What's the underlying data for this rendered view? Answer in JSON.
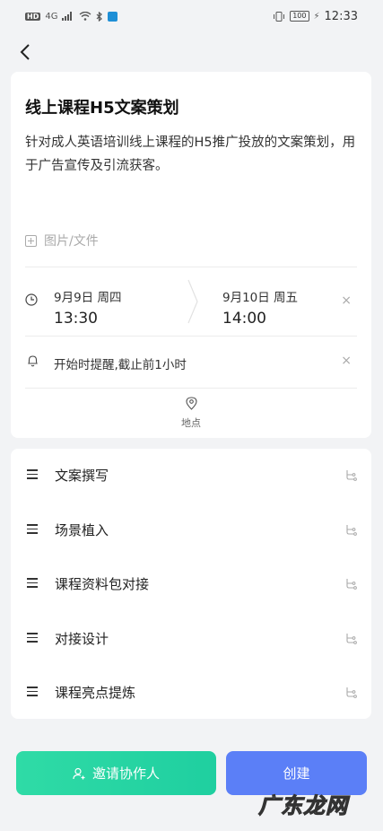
{
  "status_bar": {
    "left_badges": [
      "HD",
      "4G"
    ],
    "battery": "100",
    "time": "12:33"
  },
  "task": {
    "title": "线上课程H5文案策划",
    "description": "针对成人英语培训线上课程的H5推广投放的文案策划，用于广告宣传及引流获客。",
    "attachment_label": "图片/文件"
  },
  "schedule": {
    "start_date": "9月9日 周四",
    "start_time": "13:30",
    "end_date": "9月10日 周五",
    "end_time": "14:00",
    "clear_glyph": "×"
  },
  "reminder": {
    "text": "开始时提醒,截止前1小时",
    "clear_glyph": "×"
  },
  "location": {
    "label": "地点"
  },
  "subtasks": [
    {
      "label": "文案撰写"
    },
    {
      "label": "场景植入"
    },
    {
      "label": "课程资料包对接"
    },
    {
      "label": "对接设计"
    },
    {
      "label": "课程亮点提炼"
    }
  ],
  "actions": {
    "invite_label": "邀请协作人",
    "create_label": "创建"
  },
  "watermark": "广东龙网",
  "colors": {
    "invite_button": "#2fdba6",
    "create_button": "#5b7ff7",
    "background": "#f2f3f5"
  }
}
